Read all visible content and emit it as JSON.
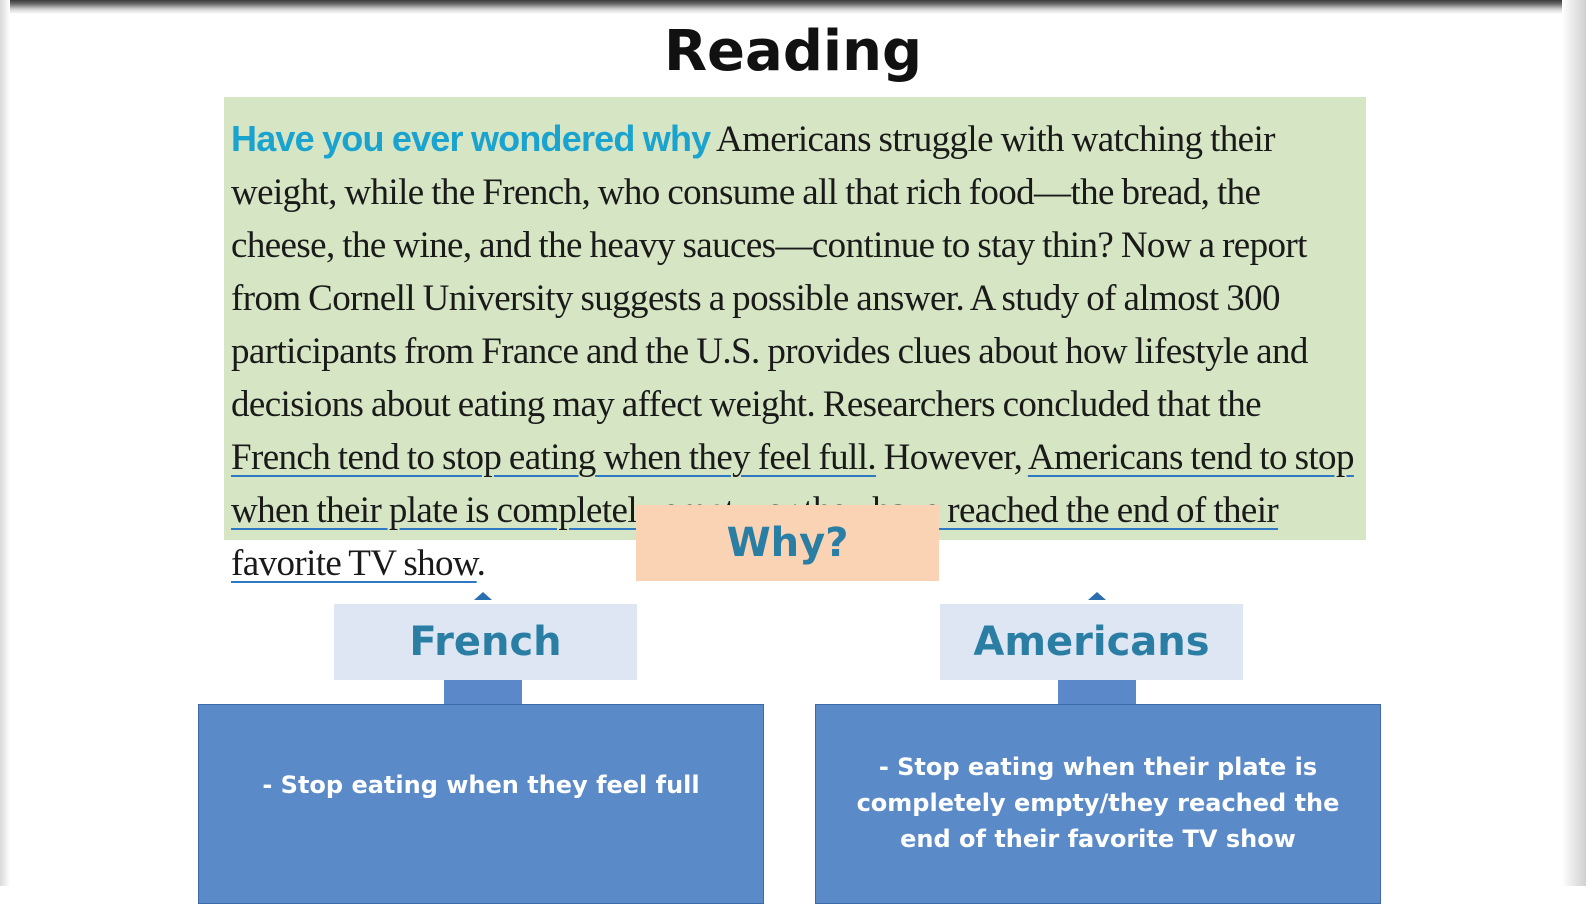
{
  "slide": {
    "title": "Reading"
  },
  "passage": {
    "lead": "Have you ever wondered why",
    "segments": [
      " Americans struggle with watching their weight, while the French, who consume all that rich food—the bread, the cheese, the wine, and the heavy sauces—continue to stay thin? Now a report from Cornell University suggests a possible answer. A study of almost 300 participants from France and the U.S. provides clues about how lifestyle and decisions about eating may affect weight. Researchers concluded that the ",
      "French tend to stop eating when they feel full.",
      " However, ",
      "Americans tend to stop when their plate is completely empty, or they have reached the end of their favorite TV show",
      "."
    ]
  },
  "diagram": {
    "question": "Why?",
    "left": {
      "label": "French",
      "detail": "- Stop eating when they feel full"
    },
    "right": {
      "label": "Americans",
      "detail": "- Stop eating when their plate is completely empty/they reached the end of their favorite TV show"
    }
  },
  "colors": {
    "passage_background": "#d6e5c4",
    "lead_text": "#1aa3cf",
    "underline": "#2f78c4",
    "question_box": "#fad3b5",
    "label_box": "#dde6f2",
    "label_text": "#2a7ea3",
    "content_box": "#5b8ac9"
  }
}
